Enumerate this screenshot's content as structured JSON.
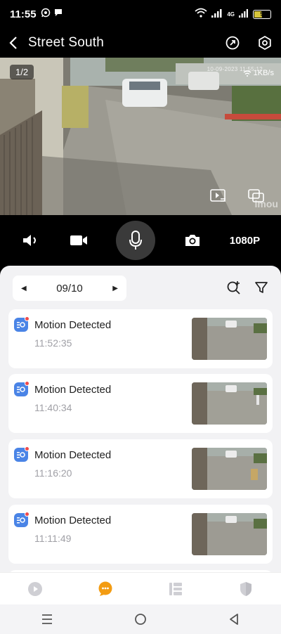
{
  "status_bar": {
    "time": "11:55",
    "network": "4G",
    "battery": "9",
    "colors": {
      "battery_fill": "#d6c43a"
    }
  },
  "header": {
    "title": "Street South",
    "icons": [
      "back-arrow-icon",
      "share-icon",
      "settings-icon"
    ]
  },
  "video": {
    "page_indicator": "1/2",
    "datetime_overlay": "10-09-2023 11:55:12",
    "speed": "1KB/s",
    "watermark": "imou",
    "icons": [
      "playback-list-icon",
      "multi-screen-icon"
    ]
  },
  "controls": {
    "resolution": "1080P",
    "icons": [
      "speaker-icon",
      "record-icon",
      "microphone-icon",
      "snapshot-icon"
    ]
  },
  "events": {
    "date": "09/10",
    "icons": [
      "search-plus-icon",
      "filter-icon"
    ],
    "items": [
      {
        "title": "Motion Detected",
        "time": "11:52:35"
      },
      {
        "title": "Motion Detected",
        "time": "11:40:34"
      },
      {
        "title": "Motion Detected",
        "time": "11:16:20"
      },
      {
        "title": "Motion Detected",
        "time": "11:11:49"
      }
    ],
    "colors": {
      "event_icon": "#4a84e6",
      "unread_dot": "#ef4b4b"
    }
  },
  "bottom_nav": {
    "items": [
      "video-tab-icon",
      "messages-tab-icon",
      "list-tab-icon",
      "security-tab-icon"
    ],
    "active": "messages-tab-icon",
    "colors": {
      "active": "#f39c12",
      "inactive": "#cfcfd4"
    }
  },
  "system_nav": {
    "icons": [
      "recent-apps-icon",
      "home-icon",
      "back-triangle-icon"
    ]
  }
}
